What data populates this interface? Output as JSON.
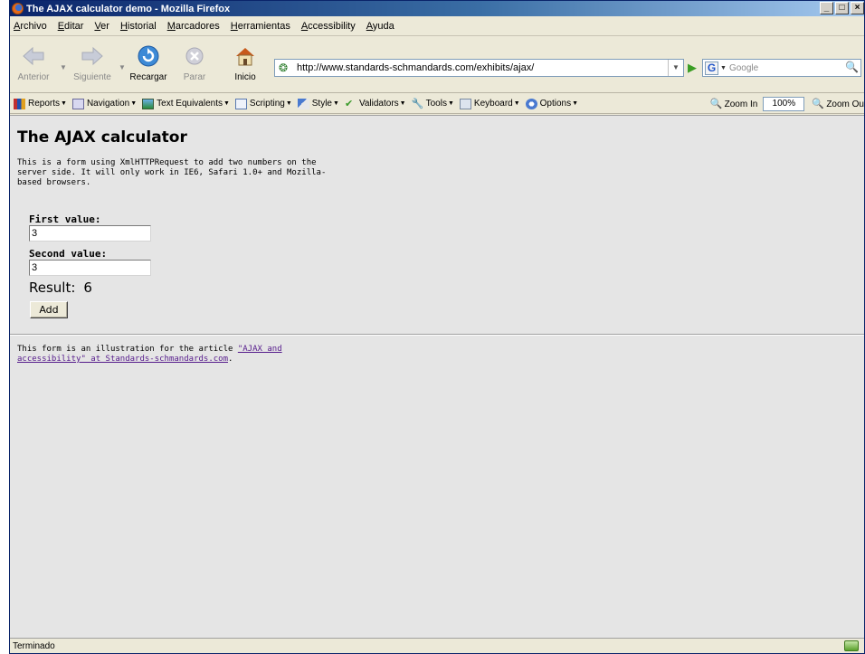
{
  "window": {
    "title": "The AJAX calculator demo - Mozilla Firefox",
    "controls": {
      "minimize": "_",
      "maximize": "□",
      "close": "×"
    }
  },
  "menubar": [
    "Archivo",
    "Editar",
    "Ver",
    "Historial",
    "Marcadores",
    "Herramientas",
    "Accessibility",
    "Ayuda"
  ],
  "navbar": {
    "back": "Anterior",
    "forward": "Siguiente",
    "reload": "Recargar",
    "stop": "Parar",
    "home": "Inicio",
    "url": "http://www.standards-schmandards.com/exhibits/ajax/",
    "search_placeholder": "Google"
  },
  "devbar": {
    "items": [
      "Reports",
      "Navigation",
      "Text Equivalents",
      "Scripting",
      "Style",
      "Validators",
      "Tools",
      "Keyboard",
      "Options"
    ],
    "zoom_in": "Zoom In",
    "zoom_value": "100%",
    "zoom_out": "Zoom Ou"
  },
  "page": {
    "title": "The AJAX calculator",
    "intro": "This is a form using XmlHTTPRequest to add two numbers on the server side. It will only work in IE6, Safari 1.0+ and Mozilla-based browsers.",
    "first_label": "First value:",
    "first_value": "3",
    "second_label": "Second value:",
    "second_value": "3",
    "result_label": "Result:",
    "result_value": "6",
    "add_button": "Add",
    "footer_prefix": "This form is an illustration for the article ",
    "footer_link": "\"AJAX and accessibility\" at Standards-schmandards.com",
    "footer_suffix": "."
  },
  "status": {
    "text": "Terminado"
  },
  "colors": {
    "titlebar": "#0a246a",
    "content_bg": "#e5e5e5",
    "link_visited": "#551a8b"
  }
}
